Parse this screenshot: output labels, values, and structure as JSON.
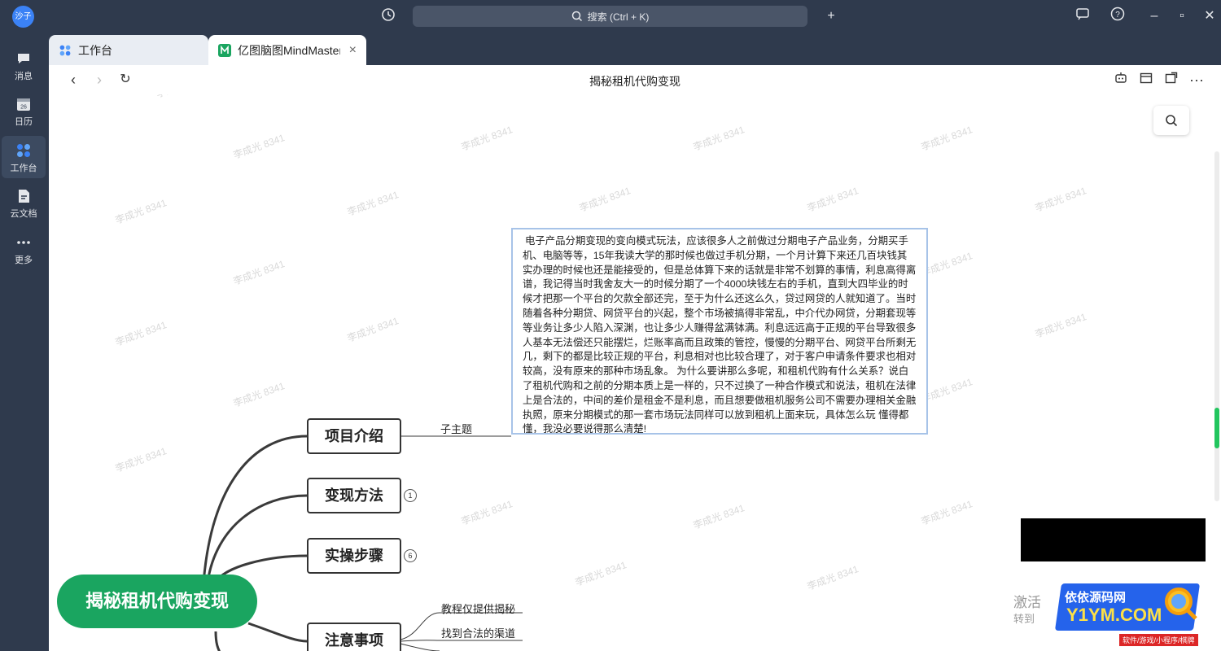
{
  "app": {
    "avatar_text": "沙子",
    "search_placeholder": "搜索 (Ctrl + K)"
  },
  "nav": [
    {
      "label": "消息",
      "icon": "message-icon"
    },
    {
      "label": "日历",
      "icon": "calendar-icon",
      "day": "26"
    },
    {
      "label": "工作台",
      "icon": "workbench-icon"
    },
    {
      "label": "云文档",
      "icon": "cloud-doc-icon"
    },
    {
      "label": "更多",
      "icon": "more-icon"
    }
  ],
  "tabs": [
    {
      "label": "工作台",
      "icon": "workbench-icon"
    },
    {
      "label": "亿图脑图MindMaster",
      "icon": "mindmaster-icon"
    }
  ],
  "page_title": "揭秘租机代购变现",
  "watermark": "李成光 8341",
  "mindmap": {
    "root": "揭秘租机代购变现",
    "topics": [
      {
        "label": "项目介绍",
        "child": "子主题"
      },
      {
        "label": "变现方法",
        "badge": "1"
      },
      {
        "label": "实操步骤",
        "badge": "6"
      },
      {
        "label": "注意事项",
        "children": [
          "教程仅提供揭秘",
          "找到合法的渠道"
        ]
      }
    ],
    "note": "电子产品分期变现的变向模式玩法，应该很多人之前做过分期电子产品业务，分期买手机、电脑等等，15年我读大学的那时候也做过手机分期，一个月计算下来还几百块钱其实办理的时候也还是能接受的，但是总体算下来的话就是非常不划算的事情，利息高得离谱，我记得当时我舍友大一的时候分期了一个4000块钱左右的手机，直到大四毕业的时候才把那一个平台的欠款全部还完，至于为什么还这么久，贷过网贷的人就知道了。当时随着各种分期贷、网贷平台的兴起，整个市场被搞得非常乱，中介代办网贷，分期套现等等业务让多少人陷入深渊，也让多少人赚得盆满钵满。利息远远高于正规的平台导致很多人基本无法偿还只能摆烂，烂账率高而且政策的管控，慢慢的分期平台、网贷平台所剩无几，剩下的都是比较正规的平台，利息相对也比较合理了，对于客户申请条件要求也相对较高，没有原来的那种市场乱象。    为什么要讲那么多呢，和租机代购有什么关系？说白了租机代购和之前的分期本质上是一样的，只不过换了一种合作模式和说法，租机在法律上是合法的，中间的差价是租金不是利息，而且想要做租机服务公司不需要办理相关金融执照，原来分期模式的那一套市场玩法同样可以放到租机上面来玩，具体怎么玩 懂得都懂，我没必要说得那么清楚!"
  },
  "overlay": {
    "activate_line1": "激活",
    "activate_line2": "转到",
    "logo_line1": "依依源码网",
    "logo_line2": "Y1YM.COM",
    "logo_line3": "软件/游戏/小程序/棋牌"
  },
  "colors": {
    "root_green": "#1aa560",
    "chrome_dark": "#2f3a4d",
    "scroll_green": "#22c55e",
    "note_border": "#a7c3e8"
  }
}
